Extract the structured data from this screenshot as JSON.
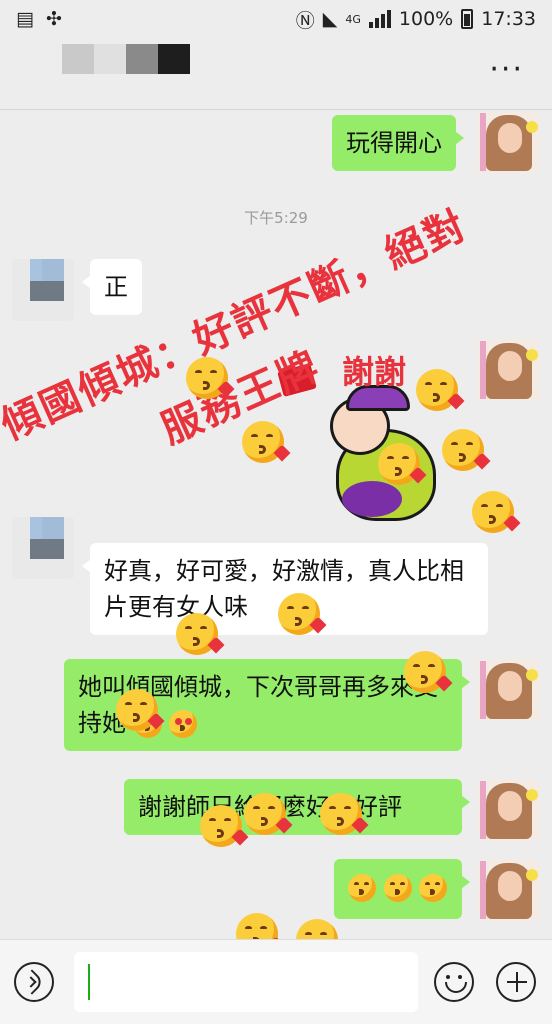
{
  "status": {
    "signal_label": "4G",
    "battery": "100%",
    "time": "17:33"
  },
  "chat": {
    "timestamp": "下午5:29",
    "messages": {
      "m1": "玩得開心",
      "m2": "正",
      "m3": "好真，好可愛，好激情，真人比相片更有女人味",
      "m4": "她叫傾國傾城，下次哥哥再多來支持她",
      "m5": "謝謝師兄給那麼好的好評"
    },
    "overlay": {
      "line1": "傾國傾城：好評不斷，絕對",
      "line2": "服務王牌",
      "thanks": "謝謝"
    }
  },
  "colors": {
    "outgoing_bubble": "#95ec69",
    "incoming_bubble": "#ffffff",
    "accent": "#1aad19",
    "overlay_text": "#e8323c"
  },
  "icons": [
    "voice-icon",
    "emoji-icon",
    "plus-icon",
    "more-icon",
    "nfc-icon",
    "wifi-icon"
  ]
}
